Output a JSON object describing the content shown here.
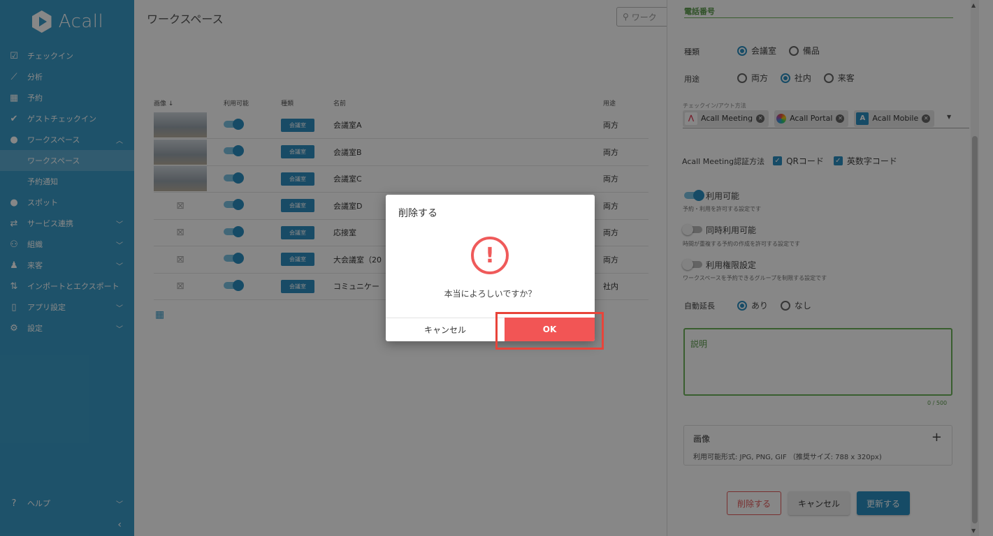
{
  "sidebar": {
    "logo": "Acall",
    "items": [
      {
        "label": "チェックイン",
        "icon": "✔"
      },
      {
        "label": "分析",
        "icon": "📈"
      },
      {
        "label": "予約",
        "icon": "🗓"
      },
      {
        "label": "ゲストチェックイン",
        "icon": "✓"
      },
      {
        "label": "ワークスペース",
        "icon": "📍"
      },
      {
        "label": "ワークスペース",
        "icon": ""
      },
      {
        "label": "予約通知",
        "icon": ""
      },
      {
        "label": "スポット",
        "icon": "📍"
      },
      {
        "label": "サービス連携",
        "icon": "⇄"
      },
      {
        "label": "組織",
        "icon": "👥"
      },
      {
        "label": "来客",
        "icon": "👤"
      },
      {
        "label": "インポートとエクスポート",
        "icon": "⇅"
      },
      {
        "label": "アプリ設定",
        "icon": "▢"
      },
      {
        "label": "設定",
        "icon": "⚙"
      }
    ],
    "help": "ヘルプ"
  },
  "main": {
    "title": "ワークスペース",
    "search_placeholder": "ワーク",
    "columns": [
      "画像",
      "利用可能",
      "種類",
      "名前",
      "用途"
    ],
    "rows": [
      {
        "name": "会議室A",
        "type": "会議室",
        "usage": "両方",
        "has_image": true
      },
      {
        "name": "会議室B",
        "type": "会議室",
        "usage": "両方",
        "has_image": true
      },
      {
        "name": "会議室C",
        "type": "会議室",
        "usage": "両方",
        "has_image": true
      },
      {
        "name": "会議室D",
        "type": "会議室",
        "usage": "両方",
        "has_image": false
      },
      {
        "name": "応接室",
        "type": "会議室",
        "usage": "両方",
        "has_image": false
      },
      {
        "name": "大会議室（20",
        "type": "会議室",
        "usage": "両方",
        "has_image": false
      },
      {
        "name": "コミュニケー",
        "type": "会議室",
        "usage": "社内",
        "has_image": false
      }
    ]
  },
  "panel": {
    "phone_label": "電話番号",
    "kind_label": "種類",
    "kind_options": [
      "会議室",
      "備品"
    ],
    "usage_label": "用途",
    "usage_options": [
      "両方",
      "社内",
      "来客"
    ],
    "checkin_label": "チェックイン/アウト方法",
    "methods": [
      "Acall Meeting",
      "Acall Portal",
      "Acall Mobile"
    ],
    "auth_label": "Acall Meeting認証方法",
    "auth_options": [
      "QRコード",
      "英数字コード"
    ],
    "available_label": "利用可能",
    "available_desc": "予約・利用を許可する設定です",
    "concurrent_label": "同時利用可能",
    "concurrent_desc": "時間が重複する予約の作成を許可する設定です",
    "permission_label": "利用権限設定",
    "permission_desc": "ワークスペースを予約できるグループを制限する設定です",
    "autoext_label": "自動延長",
    "autoext_options": [
      "あり",
      "なし"
    ],
    "description_label": "説明",
    "counter": "0 / 500",
    "image_title": "画像",
    "image_desc": "利用可能形式: JPG, PNG, GIF （推奨サイズ: 788 x 320px)",
    "delete_btn": "削除する",
    "cancel_btn": "キャンセル",
    "update_btn": "更新する"
  },
  "dialog": {
    "title": "削除する",
    "message": "本当によろしいですか？",
    "cancel": "キャンセル",
    "ok": "OK"
  }
}
